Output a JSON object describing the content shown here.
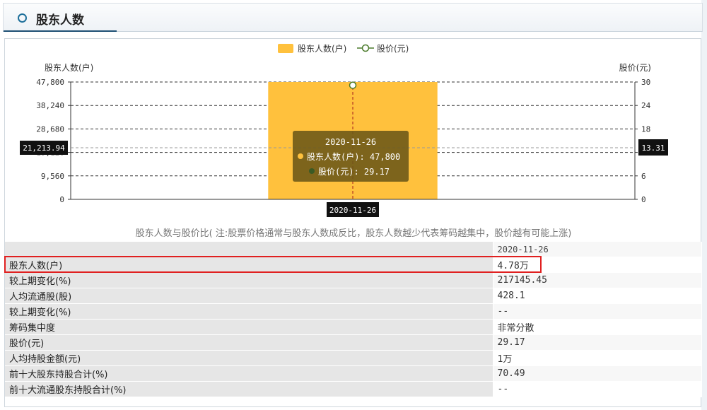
{
  "header": {
    "title": "股东人数"
  },
  "legend": {
    "holders_label": "股东人数(户)",
    "price_label": "股价(元)"
  },
  "axes": {
    "left_title": "股东人数(户)",
    "right_title": "股价(元)",
    "left_ticks": [
      "47,800",
      "38,240",
      "28,680",
      "19,120",
      "9,560",
      "0"
    ],
    "right_ticks": [
      "30",
      "24",
      "18",
      "12",
      "6",
      "0"
    ]
  },
  "crosshair": {
    "left_readout": "21,213.94",
    "right_readout": "13.31",
    "x_readout": "2020-11-26"
  },
  "tooltip": {
    "date": "2020-11-26",
    "holders_text": "股东人数(户): 47,800",
    "price_text": "股价(元): 29.17"
  },
  "caption": "股东人数与股价比( 注:股票价格通常与股东人数成反比，股东人数越少代表筹码越集中，股价越有可能上涨)",
  "table": {
    "date_header": "2020-11-26",
    "rows": [
      {
        "label": "股东人数(户)",
        "value": "4.78万"
      },
      {
        "label": "较上期变化(%)",
        "value": "217145.45"
      },
      {
        "label": "人均流通股(股)",
        "value": "428.1"
      },
      {
        "label": "较上期变化(%)",
        "value": "--"
      },
      {
        "label": "筹码集中度",
        "value": "非常分散"
      },
      {
        "label": "股价(元)",
        "value": "29.17"
      },
      {
        "label": "人均持股金额(元)",
        "value": "1万"
      },
      {
        "label": "前十大股东持股合计(%)",
        "value": "70.49"
      },
      {
        "label": "前十大流通股东持股合计(%)",
        "value": "--"
      }
    ]
  },
  "colors": {
    "bar": "#ffc13d",
    "price_line": "#4a7a2a",
    "tooltip_bg": "#6b5618",
    "highlight": "#e02020"
  },
  "chart_data": {
    "type": "bar",
    "categories": [
      "2020-11-26"
    ],
    "series": [
      {
        "name": "股东人数(户)",
        "type": "bar",
        "axis": "left",
        "values": [
          47800
        ]
      },
      {
        "name": "股价(元)",
        "type": "line",
        "axis": "right",
        "values": [
          29.17
        ]
      }
    ],
    "ylabel": "股东人数(户)",
    "ylabel_right": "股价(元)",
    "ylim": [
      0,
      47800
    ],
    "ylim_right": [
      0,
      30
    ],
    "grid": true,
    "legend": "top-center"
  }
}
